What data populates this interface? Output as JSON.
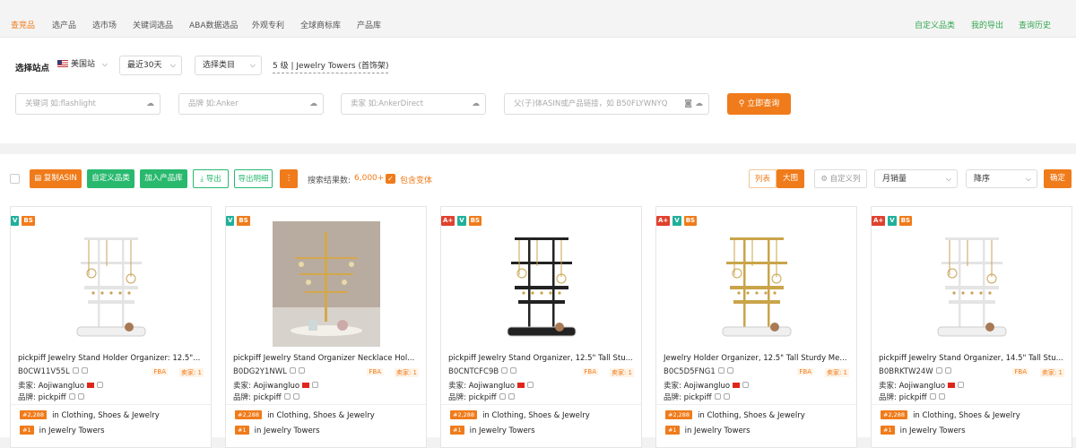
{
  "nav": {
    "tabs": [
      "查竞品",
      "选产品",
      "选市场",
      "关键词选品",
      "ABA数据选品",
      "外观专利",
      "全球商标库",
      "产品库"
    ],
    "right_links": [
      "自定义品类",
      "我的导出",
      "查询历史"
    ]
  },
  "filter": {
    "site_label": "选择站点",
    "site_value": "美国站",
    "period_value": "最近30天",
    "category_select": "选择类目",
    "category_path": "5 级 | Jewelry Towers (首饰架)",
    "inputs": [
      {
        "placeholder": "关键词 如:flashlight"
      },
      {
        "placeholder": "品牌 如:Anker"
      },
      {
        "placeholder": "卖家 如:AnkerDirect"
      },
      {
        "placeholder": "父(子)体ASIN或产品链接，如 B50FLYWNYQ"
      }
    ],
    "search_button": "立即查询"
  },
  "toolbar": {
    "copy_asin": "复制ASIN",
    "custom_category": "自定义品类",
    "add_product_lib": "加入产品库",
    "export": "导出",
    "export_detail": "导出明细",
    "more": "⋮",
    "result_label": "搜索结果数:",
    "result_count": "6,000+",
    "include_variants": "包含变体",
    "view_list": "列表",
    "view_large": "大图",
    "custom_column": "自定义列",
    "sort_field": "月销量",
    "sort_order": "降序",
    "confirm": "确定"
  },
  "products": [
    {
      "badges": [
        "V",
        "BS"
      ],
      "title": "pickpiff Jewelry Stand Holder Organizer: 12.5\"...",
      "asin": "B0CW11V55L",
      "fba": "FBA",
      "sellers": "卖家: 1",
      "seller_label": "卖家:",
      "seller": "Aojiwangluo",
      "brand_label": "品牌:",
      "brand": "pickpiff",
      "rank1": "#2,288",
      "cat1": "in Clothing, Shoes & Jewelry",
      "rank2": "#1",
      "cat2": "in Jewelry Towers",
      "style": "white"
    },
    {
      "badges": [
        "V",
        "BS"
      ],
      "title": "pickpiff Jewelry Stand Organizer Necklace Hol...",
      "asin": "B0DG2Y1NWL",
      "fba": "FBA",
      "sellers": "卖家: 1",
      "seller_label": "卖家:",
      "seller": "Aojiwangluo",
      "brand_label": "品牌:",
      "brand": "pickpiff",
      "rank1": "#2,288",
      "cat1": "in Clothing, Shoes & Jewelry",
      "rank2": "#1",
      "cat2": "in Jewelry Towers",
      "style": "photo"
    },
    {
      "badges": [
        "A+",
        "V",
        "BS"
      ],
      "title": "pickpiff Jewelry Stand Organizer, 12.5\" Tall Stu...",
      "asin": "B0CNTCFC9B",
      "fba": "FBA",
      "sellers": "卖家: 1",
      "seller_label": "卖家:",
      "seller": "Aojiwangluo",
      "brand_label": "品牌:",
      "brand": "pickpiff",
      "rank1": "#2,288",
      "cat1": "in Clothing, Shoes & Jewelry",
      "rank2": "#1",
      "cat2": "in Jewelry Towers",
      "style": "black"
    },
    {
      "badges": [
        "A+",
        "V",
        "BS"
      ],
      "title": "Jewelry Holder Organizer, 12.5\" Tall Sturdy Me...",
      "asin": "B0C5D5FNG1",
      "fba": "FBA",
      "sellers": "卖家: 1",
      "seller_label": "卖家:",
      "seller": "Aojiwangluo",
      "brand_label": "品牌:",
      "brand": "pickpiff",
      "rank1": "#2,288",
      "cat1": "in Clothing, Shoes & Jewelry",
      "rank2": "#1",
      "cat2": "in Jewelry Towers",
      "style": "gold"
    },
    {
      "badges": [
        "A+",
        "V",
        "BS"
      ],
      "title": "pickpiff Jewelry Stand Organizer, 14.5\" Tall Stu...",
      "asin": "B0BRKTW24W",
      "fba": "FBA",
      "sellers": "卖家: 1",
      "seller_label": "卖家:",
      "seller": "Aojiwangluo",
      "brand_label": "品牌:",
      "brand": "pickpiff",
      "rank1": "#2,288",
      "cat1": "in Clothing, Shoes & Jewelry",
      "rank2": "#1",
      "cat2": "in Jewelry Towers",
      "style": "white"
    }
  ]
}
